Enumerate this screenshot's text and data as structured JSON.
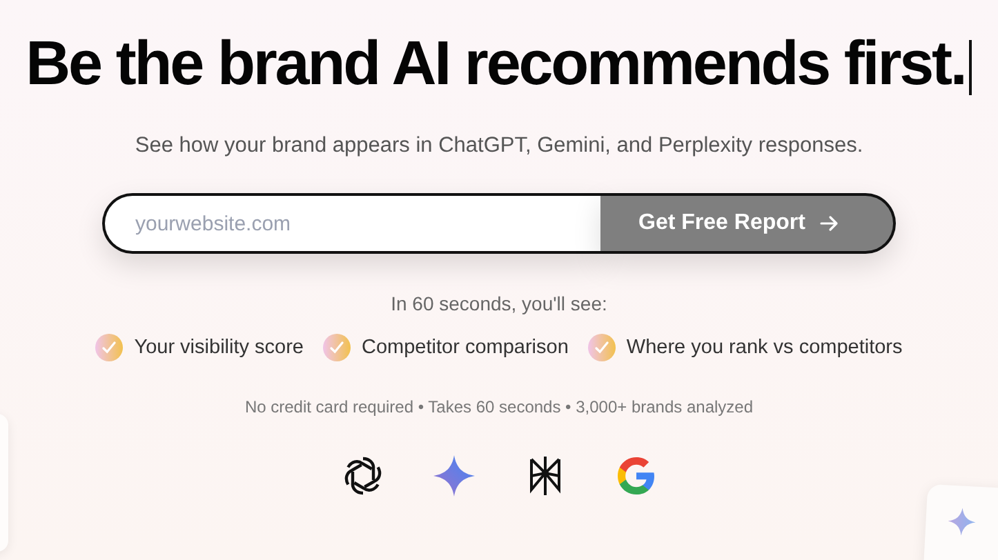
{
  "heading": "Be the brand AI recommends first.",
  "subtitle": "See how your brand appears in ChatGPT, Gemini, and Perplexity responses.",
  "form": {
    "placeholder": "yourwebsite.com",
    "button": "Get Free Report"
  },
  "intro": "In 60 seconds, you'll see:",
  "features": [
    "Your visibility score",
    "Competitor comparison",
    "Where you rank vs competitors"
  ],
  "note": "No credit card required • Takes 60 seconds • 3,000+ brands analyzed"
}
